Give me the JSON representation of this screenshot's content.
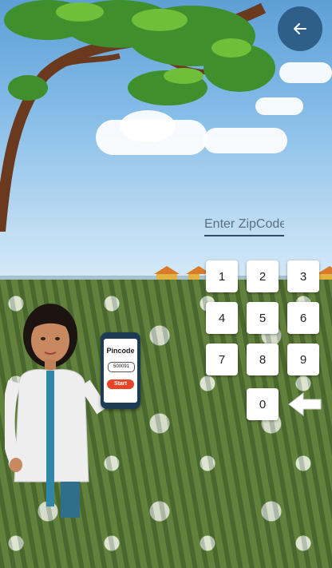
{
  "header": {
    "back_icon": "arrow-left-icon"
  },
  "zipcode": {
    "placeholder": "Enter ZipCode",
    "value": ""
  },
  "keypad": {
    "keys": [
      "1",
      "2",
      "3",
      "4",
      "5",
      "6",
      "7",
      "8",
      "9",
      "0"
    ],
    "backspace_icon": "backspace-arrow-icon"
  },
  "illustration": {
    "phone_title": "Pincode",
    "phone_pin": "500091",
    "phone_button": "Start"
  },
  "colors": {
    "accent": "#2f5f88",
    "start_button": "#e8442a"
  }
}
